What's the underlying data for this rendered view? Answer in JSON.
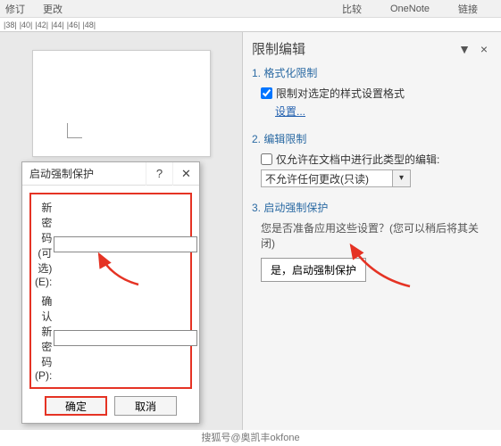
{
  "topbar": {
    "left1": "修订",
    "left2": "更改",
    "right1": "比较",
    "right2": "OneNote",
    "right3": "链接"
  },
  "ruler_marks": [
    "|38|",
    "|40|",
    "|42|",
    "|44|",
    "|46|",
    "|48|"
  ],
  "dialog": {
    "title": "启动强制保护",
    "help": "?",
    "new_pw_label": "新密码(可选)(E):",
    "confirm_pw_label": "确认新密码(P):",
    "ok": "确定",
    "cancel": "取消"
  },
  "panel": {
    "title": "限制编辑",
    "dropdown_icon": "▼",
    "close_icon": "×",
    "sec1": {
      "title": "1. 格式化限制",
      "check_label": "限制对选定的样式设置格式",
      "check_value": true,
      "link": "设置..."
    },
    "sec2": {
      "title": "2. 编辑限制",
      "check_label": "仅允许在文档中进行此类型的编辑:",
      "check_value": false,
      "select_value": "不允许任何更改(只读)"
    },
    "sec3": {
      "title": "3. 启动强制保护",
      "desc": "您是否准备应用这些设置？(您可以稍后将其关闭)",
      "button": "是，启动强制保护"
    }
  },
  "footer": "搜狐号@奥凯丰okfone"
}
